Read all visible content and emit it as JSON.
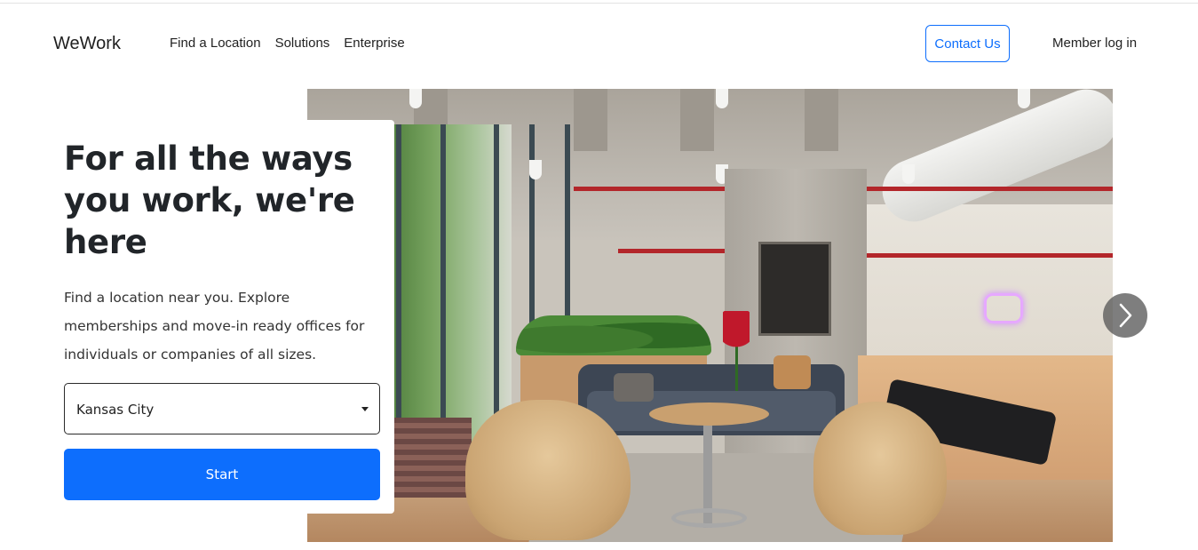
{
  "header": {
    "brand": "WeWork",
    "nav": [
      "Find a Location",
      "Solutions",
      "Enterprise"
    ],
    "contact_label": "Contact Us",
    "member_login_label": "Member log in"
  },
  "hero": {
    "headline": "For all the ways you work, we're here",
    "subtext": "Find a location near you. Explore memberships and move-in ready offices for individuals or companies of all sizes.",
    "location_select": {
      "selected": "Kansas City"
    },
    "start_label": "Start",
    "carousel_next_icon": "chevron-right-icon"
  },
  "colors": {
    "primary": "#0d6efd",
    "text": "#212529",
    "carousel_control": "#5a5a5a"
  }
}
